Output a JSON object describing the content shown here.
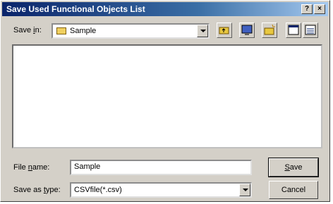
{
  "window": {
    "title": "Save Used Functional Objects List",
    "help_label": "?",
    "close_label": "×"
  },
  "save_in": {
    "label_prefix": "Save ",
    "label_underlined": "i",
    "label_suffix": "n:",
    "value": "Sample"
  },
  "toolbar": {
    "icons": [
      "up-one-level-icon",
      "desktop-icon",
      "create-new-folder-icon",
      "list-view-icon",
      "details-view-icon"
    ]
  },
  "file_name": {
    "label_prefix": "File ",
    "label_underlined": "n",
    "label_suffix": "ame:",
    "value": "Sample"
  },
  "save_as_type": {
    "label_prefix": "Save as ",
    "label_underlined": "t",
    "label_suffix": "ype:",
    "value": "CSVfile(*.csv)"
  },
  "buttons": {
    "save_underlined": "S",
    "save_rest": "ave",
    "cancel_label": "Cancel"
  },
  "colors": {
    "titlebar_start": "#0a246a",
    "face": "#d4d0c8"
  }
}
